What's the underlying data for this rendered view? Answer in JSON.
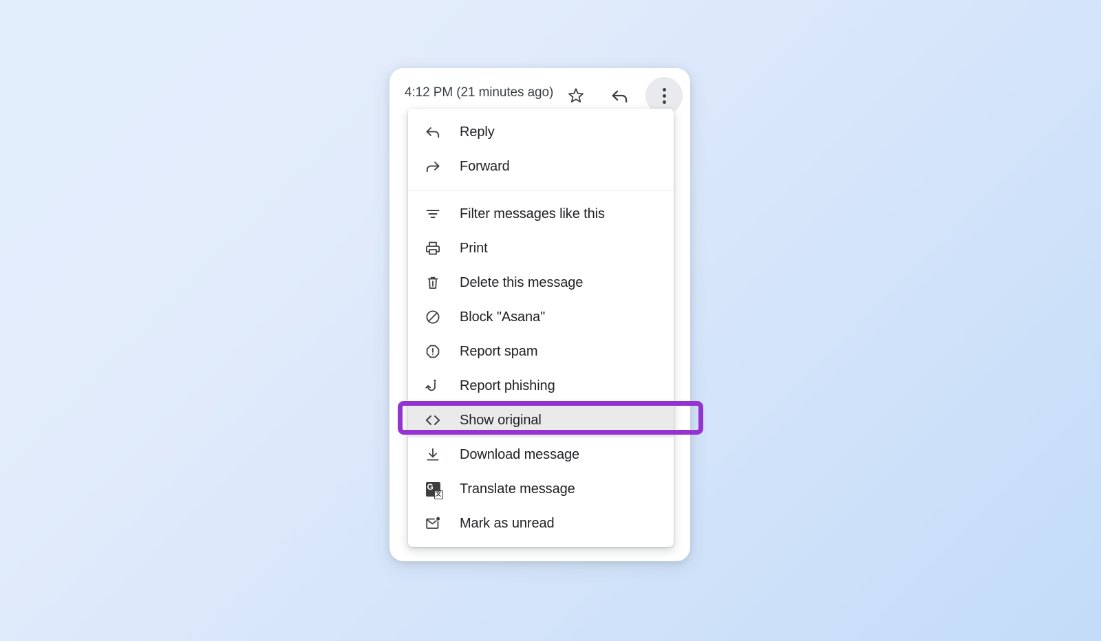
{
  "background": {
    "gradient_from": "#e3eefc",
    "gradient_to": "#c3dcf8"
  },
  "email_card": {
    "timestamp": "4:12 PM (21 minutes ago)",
    "actions": [
      {
        "name": "star-button",
        "icon": "star-icon",
        "label": "Star"
      },
      {
        "name": "reply-button",
        "icon": "reply-arrow-icon",
        "label": "Reply"
      },
      {
        "name": "more-button",
        "icon": "more-vert-icon",
        "label": "More"
      }
    ]
  },
  "context_menu": {
    "groups": [
      {
        "items": [
          {
            "icon": "reply-arrow-icon",
            "label": "Reply"
          },
          {
            "icon": "forward-arrow-icon",
            "label": "Forward"
          }
        ]
      },
      {
        "items": [
          {
            "icon": "filter-icon",
            "label": "Filter messages like this"
          },
          {
            "icon": "print-icon",
            "label": "Print"
          },
          {
            "icon": "trash-icon",
            "label": "Delete this message"
          },
          {
            "icon": "block-icon",
            "label": "Block \"Asana\""
          },
          {
            "icon": "report-spam-icon",
            "label": "Report spam"
          },
          {
            "icon": "phishing-hook-icon",
            "label": "Report phishing"
          },
          {
            "icon": "code-brackets-icon",
            "label": "Show original",
            "highlighted": true
          },
          {
            "icon": "download-icon",
            "label": "Download message"
          },
          {
            "icon": "translate-icon",
            "label": "Translate message"
          },
          {
            "icon": "mark-unread-icon",
            "label": "Mark as unread"
          }
        ]
      }
    ]
  },
  "highlight": {
    "target_label": "Show original",
    "color": "#9333d0",
    "border_width_px": 7
  }
}
